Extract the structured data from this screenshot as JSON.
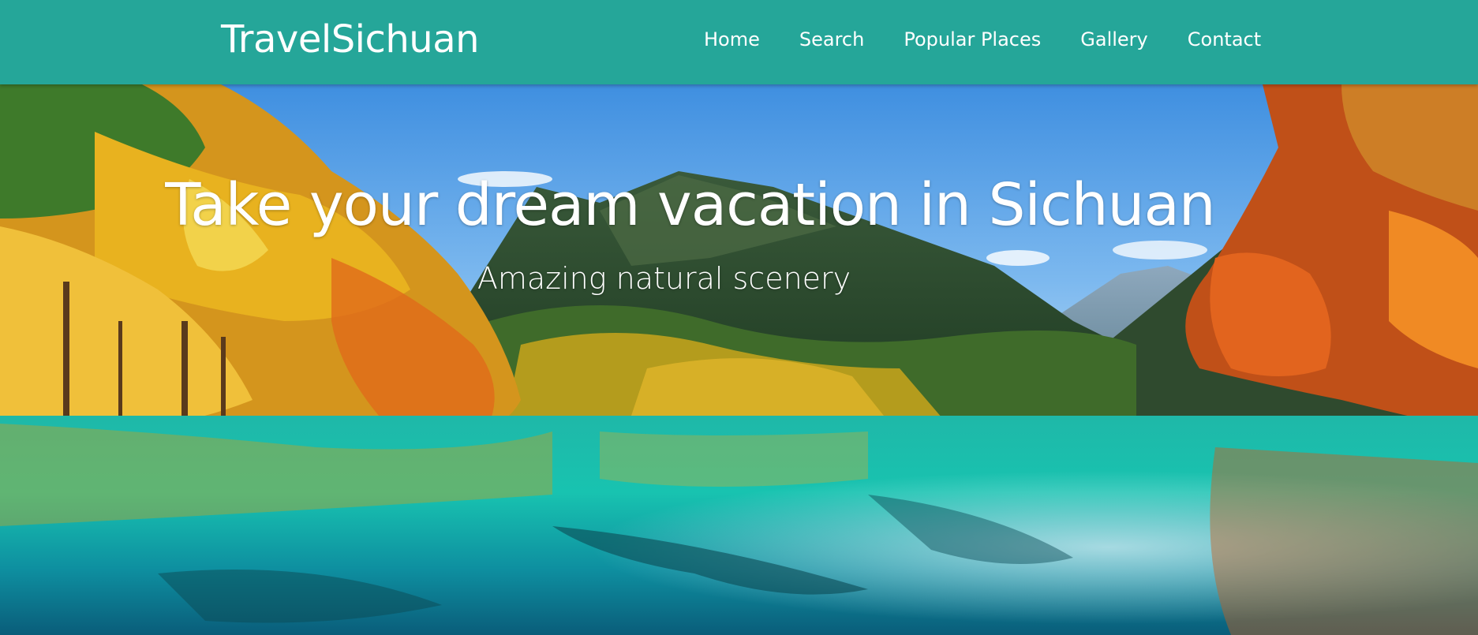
{
  "navbar": {
    "brand": "TravelSichuan",
    "links": [
      {
        "label": "Home"
      },
      {
        "label": "Search"
      },
      {
        "label": "Popular Places"
      },
      {
        "label": "Gallery"
      },
      {
        "label": "Contact"
      }
    ]
  },
  "hero": {
    "title": "Take your dream vacation in Sichuan",
    "subtitle": "Amazing natural scenery",
    "image": "hero-landscape-lake-autumn-forest"
  },
  "colors": {
    "navbar_bg": "#25a699",
    "text": "#ffffff"
  }
}
